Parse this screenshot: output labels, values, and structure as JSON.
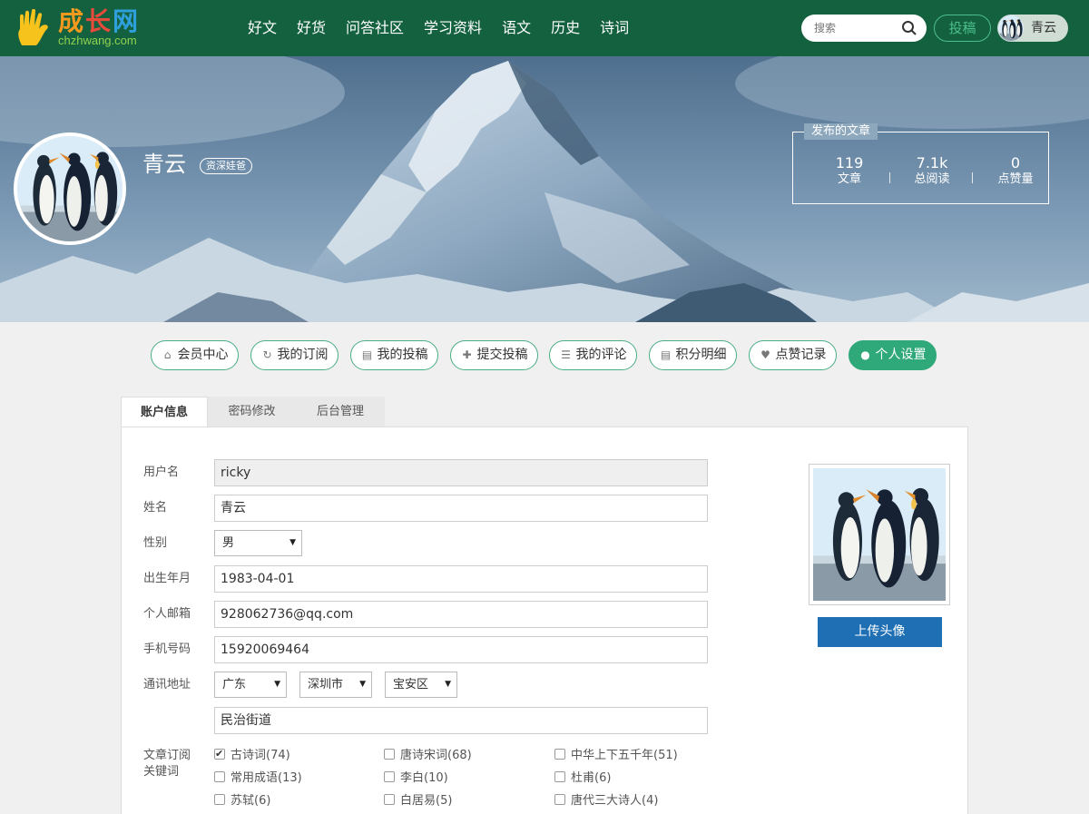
{
  "header": {
    "logo_cn": [
      "成",
      "长",
      "网"
    ],
    "logo_en": "chzhwang.com",
    "nav": [
      "好文",
      "好货",
      "问答社区",
      "学习资料",
      "语文",
      "历史",
      "诗词"
    ],
    "search_placeholder": "搜索",
    "submit_label": "投稿",
    "user_name": "青云"
  },
  "profile": {
    "name": "青云",
    "badge": "资深娃爸",
    "stats_title": "发布的文章",
    "stats": [
      {
        "num": "119",
        "label": "文章"
      },
      {
        "num": "7.1k",
        "label": "总阅读"
      },
      {
        "num": "0",
        "label": "点赞量"
      }
    ]
  },
  "menu": [
    {
      "label": "会员中心",
      "icon": "home-icon"
    },
    {
      "label": "我的订阅",
      "icon": "refresh-icon"
    },
    {
      "label": "我的投稿",
      "icon": "document-icon"
    },
    {
      "label": "提交投稿",
      "icon": "plus-icon"
    },
    {
      "label": "我的评论",
      "icon": "list-icon"
    },
    {
      "label": "积分明细",
      "icon": "document-icon"
    },
    {
      "label": "点赞记录",
      "icon": "heart-icon"
    },
    {
      "label": "个人设置",
      "icon": "user-icon"
    }
  ],
  "tabs": [
    "账户信息",
    "密码修改",
    "后台管理"
  ],
  "form": {
    "username_label": "用户名",
    "username": "ricky",
    "name_label": "姓名",
    "name": "青云",
    "gender_label": "性别",
    "gender": "男",
    "birth_label": "出生年月",
    "birth": "1983-04-01",
    "email_label": "个人邮箱",
    "email": "928062736@qq.com",
    "phone_label": "手机号码",
    "phone": "15920069464",
    "address_label": "通讯地址",
    "province": "广东",
    "city": "深圳市",
    "district": "宝安区",
    "street": "民治街道",
    "keywords_label_1": "文章订阅",
    "keywords_label_2": "关键词",
    "keywords": [
      {
        "label": "古诗词(74)",
        "checked": true
      },
      {
        "label": "唐诗宋词(68)",
        "checked": false
      },
      {
        "label": "中华上下五千年(51)",
        "checked": false
      },
      {
        "label": "常用成语(13)",
        "checked": false
      },
      {
        "label": "李白(10)",
        "checked": false
      },
      {
        "label": "杜甫(6)",
        "checked": false
      },
      {
        "label": "苏轼(6)",
        "checked": false
      },
      {
        "label": "白居易(5)",
        "checked": false
      },
      {
        "label": "唐代三大诗人(4)",
        "checked": false
      }
    ]
  },
  "upload_label": "上传头像"
}
